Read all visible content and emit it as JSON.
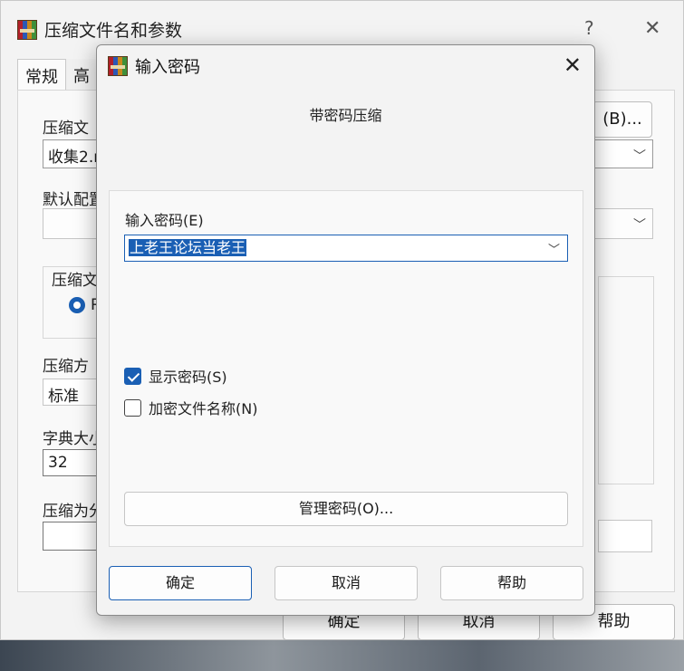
{
  "back_window": {
    "title": "压缩文件名和参数",
    "help_glyph": "?",
    "close_glyph": "✕",
    "tabs": [
      "常规",
      "高"
    ],
    "labels": {
      "archive_name": "压缩文",
      "default_config": "默认配置",
      "archive_format": "压缩文",
      "compress_method": "压缩方",
      "dict_size": "字典大小",
      "split_volumes": "压缩为分"
    },
    "fields": {
      "archive_name_value": "收集2.r",
      "compress_method_value": "标准",
      "dict_size_value": "32"
    },
    "radio_label": "R",
    "browse_button": "(B)...",
    "buttons": {
      "ok": "确定",
      "cancel": "取消",
      "help": "帮助"
    }
  },
  "dialog": {
    "title": "输入密码",
    "close_glyph": "✕",
    "header": "带密码压缩",
    "password_label": "输入密码(E)",
    "password_value": "上老王论坛当老王",
    "show_password": {
      "label": "显示密码(S)",
      "checked": true
    },
    "encrypt_names": {
      "label": "加密文件名称(N)",
      "checked": false
    },
    "manage_button": "管理密码(O)...",
    "buttons": {
      "ok": "确定",
      "cancel": "取消",
      "help": "帮助"
    }
  }
}
